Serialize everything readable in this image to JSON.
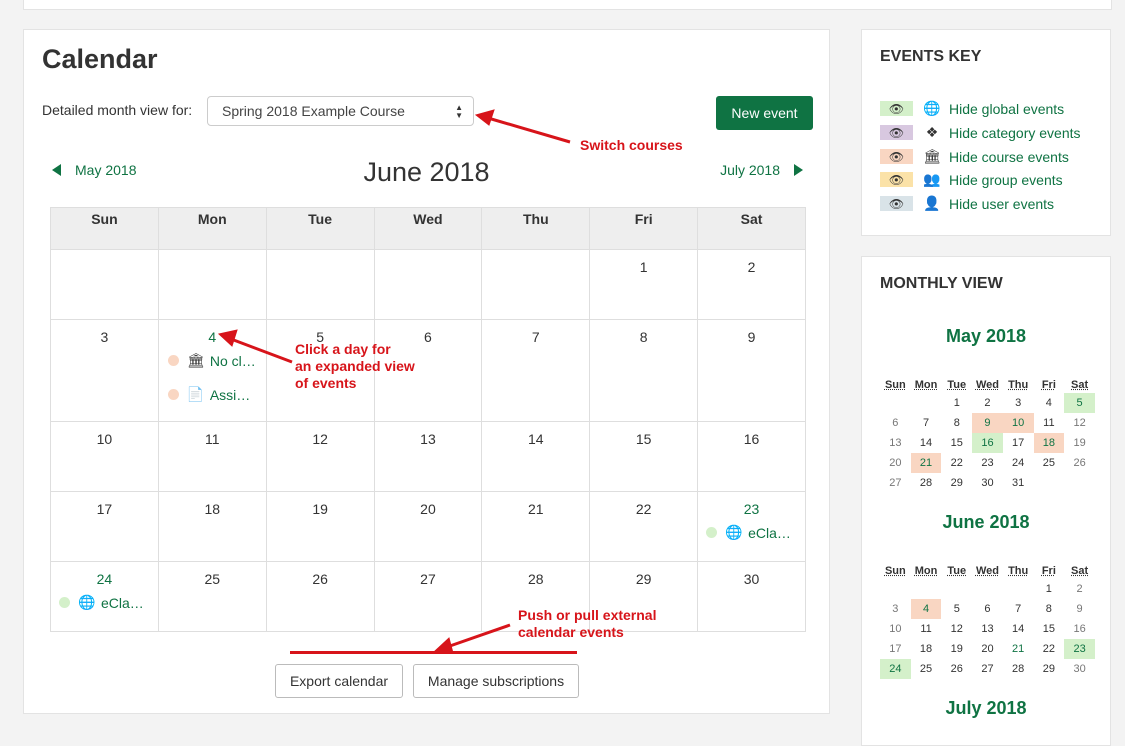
{
  "main": {
    "title": "Calendar",
    "detailed_label": "Detailed month view for:",
    "course_select": "Spring 2018 Example Course",
    "new_event": "New event",
    "prev_month": "May 2018",
    "next_month": "July 2018",
    "month_title": "June 2018",
    "weekdays": [
      "Sun",
      "Mon",
      "Tue",
      "Wed",
      "Thu",
      "Fri",
      "Sat"
    ],
    "weeks": [
      [
        "",
        "",
        "",
        "",
        "",
        "1",
        "2"
      ],
      [
        "3",
        "4",
        "5",
        "6",
        "7",
        "8",
        "9"
      ],
      [
        "10",
        "11",
        "12",
        "13",
        "14",
        "15",
        "16"
      ],
      [
        "17",
        "18",
        "19",
        "20",
        "21",
        "22",
        "23"
      ],
      [
        "24",
        "25",
        "26",
        "27",
        "28",
        "29",
        "30"
      ]
    ],
    "events": {
      "d4_a": "No cl…",
      "d4_b": "Assi…",
      "d23": "eCla…",
      "d24": "eCla…"
    },
    "export_btn": "Export calendar",
    "manage_btn": "Manage subscriptions"
  },
  "annotations": {
    "switch_courses": "Switch courses",
    "click_day_1": "Click a day for",
    "click_day_2": "an expanded view",
    "click_day_3": "of events",
    "push_pull_1": "Push or pull external",
    "push_pull_2": "calendar events"
  },
  "events_key": {
    "heading": "EVENTS KEY",
    "items": [
      {
        "label": "Hide global events",
        "color": "#d4f0ca",
        "icon": "globe-icon"
      },
      {
        "label": "Hide category events",
        "color": "#d8c8e0",
        "icon": "cubes-icon"
      },
      {
        "label": "Hide course events",
        "color": "#f9d6c2",
        "icon": "institution-icon"
      },
      {
        "label": "Hide group events",
        "color": "#fbe2a8",
        "icon": "group-icon"
      },
      {
        "label": "Hide user events",
        "color": "#d9e3e8",
        "icon": "user-icon"
      }
    ]
  },
  "monthly_view": {
    "heading": "MONTHLY VIEW",
    "may_title": "May 2018",
    "june_title": "June 2018",
    "july_title": "July 2018",
    "weekdays": [
      "Sun",
      "Mon",
      "Tue",
      "Wed",
      "Thu",
      "Fri",
      "Sat"
    ],
    "may_weeks": [
      [
        "",
        "",
        "1",
        "2",
        "3",
        "4",
        "5"
      ],
      [
        "6",
        "7",
        "8",
        "9",
        "10",
        "11",
        "12"
      ],
      [
        "13",
        "14",
        "15",
        "16",
        "17",
        "18",
        "19"
      ],
      [
        "20",
        "21",
        "22",
        "23",
        "24",
        "25",
        "26"
      ],
      [
        "27",
        "28",
        "29",
        "30",
        "31",
        "",
        ""
      ]
    ],
    "june_weeks": [
      [
        "",
        "",
        "",
        "",
        "",
        "1",
        "2"
      ],
      [
        "3",
        "4",
        "5",
        "6",
        "7",
        "8",
        "9"
      ],
      [
        "10",
        "11",
        "12",
        "13",
        "14",
        "15",
        "16"
      ],
      [
        "17",
        "18",
        "19",
        "20",
        "21",
        "22",
        "23"
      ],
      [
        "24",
        "25",
        "26",
        "27",
        "28",
        "29",
        "30"
      ]
    ]
  },
  "colors": {
    "brand": "#0f7343",
    "annotation": "#d7141a",
    "global": "#d4f0ca",
    "course": "#f9d6c2"
  }
}
